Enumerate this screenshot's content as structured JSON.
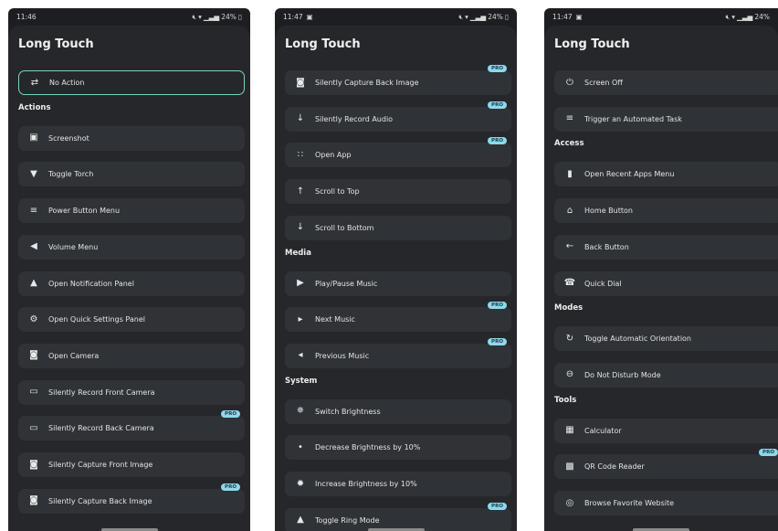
{
  "phones": [
    {
      "status": {
        "time": "11:46",
        "battery": "24%"
      },
      "title": "Long Touch",
      "items": [
        {
          "type": "row",
          "label": "No Action",
          "icon": "swap-arrows-icon",
          "selected": true
        },
        {
          "type": "section",
          "label": "Actions"
        },
        {
          "type": "row",
          "label": "Screenshot",
          "icon": "screenshot-icon"
        },
        {
          "type": "row",
          "label": "Toggle Torch",
          "icon": "torch-icon"
        },
        {
          "type": "row",
          "label": "Power Button Menu",
          "icon": "menu-lines-icon"
        },
        {
          "type": "row",
          "label": "Volume Menu",
          "icon": "volume-icon"
        },
        {
          "type": "row",
          "label": "Open Notification Panel",
          "icon": "bell-icon"
        },
        {
          "type": "row",
          "label": "Open Quick Settings Panel",
          "icon": "gear-icon"
        },
        {
          "type": "row",
          "label": "Open Camera",
          "icon": "camera-icon"
        },
        {
          "type": "row",
          "label": "Silently Record Front Camera",
          "icon": "video-camera-icon"
        },
        {
          "type": "row",
          "label": "Silently Record Back Camera",
          "icon": "video-camera-icon",
          "pro": "PRO"
        },
        {
          "type": "row",
          "label": "Silently Capture Front Image",
          "icon": "camera-icon"
        },
        {
          "type": "row",
          "label": "Silently Capture Back Image",
          "icon": "camera-icon",
          "pro": "PRO"
        }
      ]
    },
    {
      "status": {
        "time": "11:47",
        "battery": "24%"
      },
      "title": "Long Touch",
      "items": [
        {
          "type": "row",
          "label": "Silently Capture Back Image",
          "icon": "camera-icon",
          "pro": "PRO"
        },
        {
          "type": "row",
          "label": "Silently Record Audio",
          "icon": "microphone-icon",
          "pro": "PRO"
        },
        {
          "type": "row",
          "label": "Open App",
          "icon": "app-grid-icon",
          "pro": "PRO"
        },
        {
          "type": "row",
          "label": "Scroll to Top",
          "icon": "arrow-up-icon"
        },
        {
          "type": "row",
          "label": "Scroll to Bottom",
          "icon": "arrow-down-icon"
        },
        {
          "type": "section",
          "label": "Media"
        },
        {
          "type": "row",
          "label": "Play/Pause Music",
          "icon": "play-pause-icon"
        },
        {
          "type": "row",
          "label": "Next Music",
          "icon": "skip-next-icon",
          "pro": "PRO"
        },
        {
          "type": "row",
          "label": "Previous Music",
          "icon": "skip-previous-icon",
          "pro": "PRO"
        },
        {
          "type": "section",
          "label": "System"
        },
        {
          "type": "row",
          "label": "Switch Brightness",
          "icon": "brightness-icon"
        },
        {
          "type": "row",
          "label": "Decrease Brightness by 10%",
          "icon": "brightness-low-icon"
        },
        {
          "type": "row",
          "label": "Increase Brightness by 10%",
          "icon": "brightness-high-icon"
        },
        {
          "type": "row",
          "label": "Toggle Ring Mode",
          "icon": "ring-bell-icon",
          "pro": "PRO"
        }
      ]
    },
    {
      "status": {
        "time": "11:47",
        "battery": "24%"
      },
      "title": "Long Touch",
      "items": [
        {
          "type": "row",
          "label": "Screen Off",
          "icon": "power-icon"
        },
        {
          "type": "row",
          "label": "Trigger an Automated Task",
          "icon": "list-icon"
        },
        {
          "type": "section",
          "label": "Access"
        },
        {
          "type": "row",
          "label": "Open Recent Apps Menu",
          "icon": "recent-apps-icon"
        },
        {
          "type": "row",
          "label": "Home Button",
          "icon": "home-icon"
        },
        {
          "type": "row",
          "label": "Back Button",
          "icon": "back-icon"
        },
        {
          "type": "row",
          "label": "Quick Dial",
          "icon": "phone-icon"
        },
        {
          "type": "section",
          "label": "Modes"
        },
        {
          "type": "row",
          "label": "Toggle Automatic Orientation",
          "icon": "rotate-icon"
        },
        {
          "type": "row",
          "label": "Do Not Disturb Mode",
          "icon": "do-not-disturb-icon"
        },
        {
          "type": "section",
          "label": "Tools"
        },
        {
          "type": "row",
          "label": "Calculator",
          "icon": "calculator-icon"
        },
        {
          "type": "row",
          "label": "QR Code Reader",
          "icon": "qr-code-icon",
          "pro": "PRO"
        },
        {
          "type": "row",
          "label": "Browse Favorite Website",
          "icon": "globe-icon"
        }
      ]
    }
  ],
  "colors": {
    "background": "#1c1e21",
    "sheet": "#25272b",
    "row": "#2f3236",
    "selected_border": "#7bd3c4",
    "pro_badge": "#8ed8ec"
  }
}
